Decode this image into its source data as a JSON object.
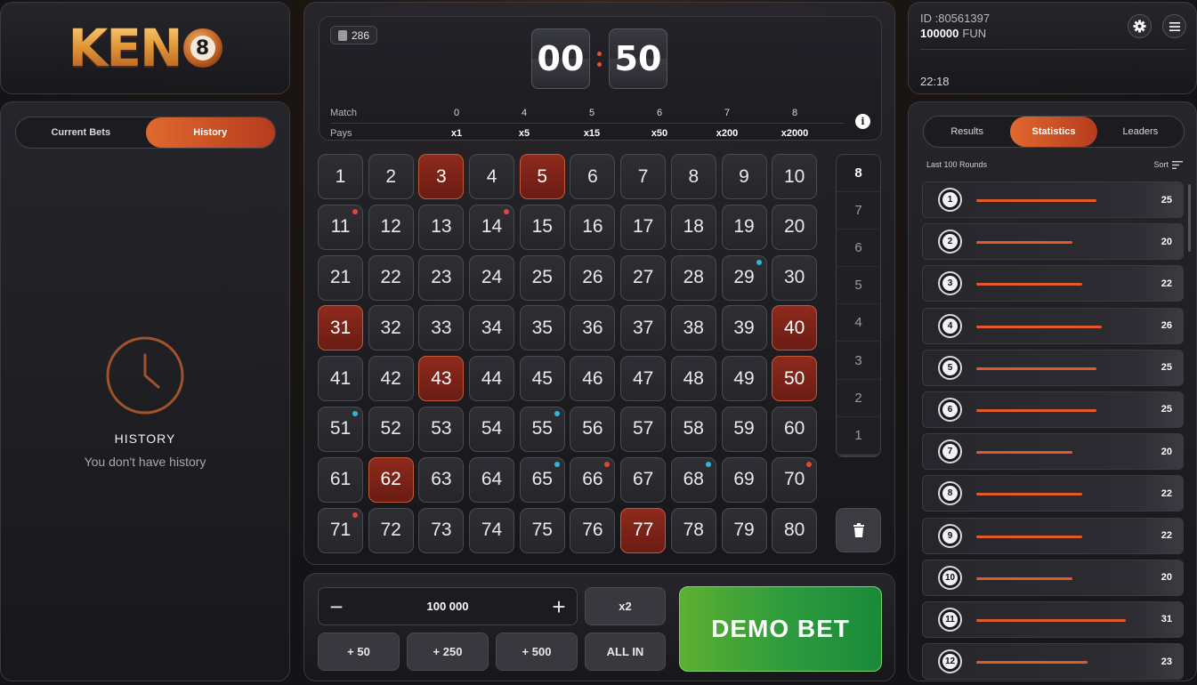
{
  "logo": {
    "text": "KEN",
    "ball_digit": "8"
  },
  "left_tabs": [
    {
      "label": "Current Bets",
      "active": false
    },
    {
      "label": "History",
      "active": true
    }
  ],
  "history_empty": {
    "title": "HISTORY",
    "subtitle": "You don't have history",
    "icon": "clock-icon"
  },
  "round": {
    "number": "286",
    "icon": "document-icon"
  },
  "timer": {
    "minutes": "00",
    "seconds": "50"
  },
  "paytable": {
    "match_label": "Match",
    "pays_label": "Pays",
    "matches": [
      "0",
      "4",
      "5",
      "6",
      "7",
      "8"
    ],
    "pays": [
      "x1",
      "x5",
      "x15",
      "x50",
      "x200",
      "x2000"
    ]
  },
  "numbers": {
    "values": [
      "1",
      "2",
      "3",
      "4",
      "5",
      "6",
      "7",
      "8",
      "9",
      "10",
      "11",
      "12",
      "13",
      "14",
      "15",
      "16",
      "17",
      "18",
      "19",
      "20",
      "21",
      "22",
      "23",
      "24",
      "25",
      "26",
      "27",
      "28",
      "29",
      "30",
      "31",
      "32",
      "33",
      "34",
      "35",
      "36",
      "37",
      "38",
      "39",
      "40",
      "41",
      "42",
      "43",
      "44",
      "45",
      "46",
      "47",
      "48",
      "49",
      "50",
      "51",
      "52",
      "53",
      "54",
      "55",
      "56",
      "57",
      "58",
      "59",
      "60",
      "61",
      "62",
      "63",
      "64",
      "65",
      "66",
      "67",
      "68",
      "69",
      "70",
      "71",
      "72",
      "73",
      "74",
      "75",
      "76",
      "77",
      "78",
      "79",
      "80"
    ],
    "highlighted": [
      3,
      5,
      31,
      40,
      43,
      50,
      62,
      77
    ],
    "red_dots": [
      11,
      14,
      66,
      70,
      71
    ],
    "blue_dots": [
      29,
      51,
      55,
      65,
      68
    ]
  },
  "picks": [
    "8",
    "7",
    "6",
    "5",
    "4",
    "3",
    "2",
    "1"
  ],
  "colors": {
    "accent": "#e0692e",
    "hit": "#8e2a1c",
    "bet_green": "#2c9a3d",
    "dot_red": "#e0463a",
    "dot_blue": "#2fb7d8"
  },
  "bet": {
    "amount": "100 000",
    "minus": "−",
    "plus": "+",
    "double": "x2",
    "quick": [
      "+ 50",
      "+ 250",
      "+ 500"
    ],
    "all_in": "ALL IN",
    "demo_bet": "DEMO BET"
  },
  "account": {
    "id": "ID :80561397",
    "balance": "100000",
    "currency": "FUN",
    "time": "22:18"
  },
  "right_tabs": [
    {
      "label": "Results",
      "active": false
    },
    {
      "label": "Statistics",
      "active": true
    },
    {
      "label": "Leaders",
      "active": false
    }
  ],
  "stats": {
    "header": "Last 100 Rounds",
    "sort_label": "Sort",
    "rows": [
      {
        "ball": "1",
        "count": "25"
      },
      {
        "ball": "2",
        "count": "20"
      },
      {
        "ball": "3",
        "count": "22"
      },
      {
        "ball": "4",
        "count": "26"
      },
      {
        "ball": "5",
        "count": "25"
      },
      {
        "ball": "6",
        "count": "25"
      },
      {
        "ball": "7",
        "count": "20"
      },
      {
        "ball": "8",
        "count": "22"
      },
      {
        "ball": "9",
        "count": "22"
      },
      {
        "ball": "10",
        "count": "20"
      },
      {
        "ball": "11",
        "count": "31"
      },
      {
        "ball": "12",
        "count": "23"
      }
    ]
  }
}
